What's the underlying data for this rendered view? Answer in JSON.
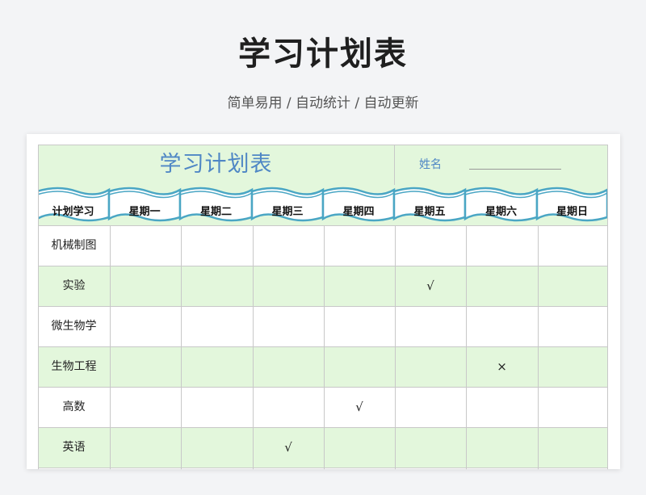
{
  "page": {
    "title": "学习计划表",
    "subtitle": "简单易用  /  自动统计  /  自动更新"
  },
  "sheet": {
    "title": "学习计划表",
    "name_label": "姓名",
    "banner_color": "#4aa6c4",
    "band_color": "#e3f7dc",
    "days": [
      "计划学习",
      "星期一",
      "星期二",
      "星期三",
      "星期四",
      "星期五",
      "星期六",
      "星期日"
    ],
    "rows": [
      {
        "label": "机械制图",
        "marks": [
          "",
          "",
          "",
          "",
          "",
          "",
          ""
        ]
      },
      {
        "label": "实验",
        "marks": [
          "",
          "",
          "",
          "",
          "√",
          "",
          ""
        ]
      },
      {
        "label": "微生物学",
        "marks": [
          "",
          "",
          "",
          "",
          "",
          "",
          ""
        ]
      },
      {
        "label": "生物工程",
        "marks": [
          "",
          "",
          "",
          "",
          "",
          "×",
          ""
        ]
      },
      {
        "label": "高数",
        "marks": [
          "",
          "",
          "",
          "√",
          "",
          "",
          ""
        ]
      },
      {
        "label": "英语",
        "marks": [
          "",
          "",
          "√",
          "",
          "",
          "",
          ""
        ]
      }
    ]
  }
}
